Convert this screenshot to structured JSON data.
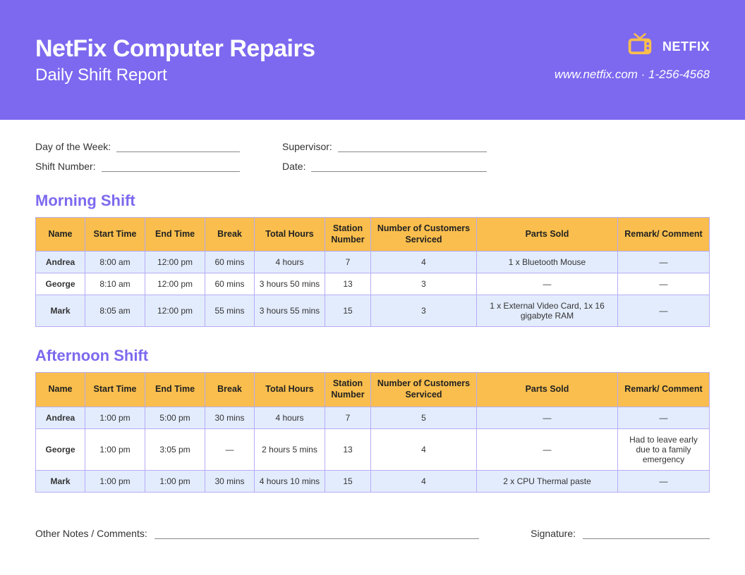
{
  "header": {
    "title": "NetFix Computer Repairs",
    "subtitle": "Daily Shift Report",
    "brand": "NETFIX",
    "contact": "www.netfix.com · 1-256-4568"
  },
  "meta": {
    "day_label": "Day of the Week:",
    "shift_label": "Shift Number:",
    "supervisor_label": "Supervisor:",
    "date_label": "Date:"
  },
  "columns": {
    "name": "Name",
    "start": "Start Time",
    "end": "End Time",
    "break": "Break",
    "total": "Total Hours",
    "station": "Station Number",
    "customers": "Number of Customers Serviced",
    "parts": "Parts Sold",
    "remark": "Remark/ Comment"
  },
  "sections": {
    "morning": {
      "title": "Morning Shift",
      "rows": [
        {
          "name": "Andrea",
          "start": "8:00 am",
          "end": "12:00 pm",
          "break": "60 mins",
          "total": "4 hours",
          "station": "7",
          "customers": "4",
          "parts": "1 x Bluetooth Mouse",
          "remark": "—"
        },
        {
          "name": "George",
          "start": "8:10 am",
          "end": "12:00 pm",
          "break": "60 mins",
          "total": "3 hours 50 mins",
          "station": "13",
          "customers": "3",
          "parts": "—",
          "remark": "—"
        },
        {
          "name": "Mark",
          "start": "8:05 am",
          "end": "12:00 pm",
          "break": "55 mins",
          "total": "3 hours 55 mins",
          "station": "15",
          "customers": "3",
          "parts": "1 x External Video Card, 1x 16 gigabyte RAM",
          "remark": "—"
        }
      ]
    },
    "afternoon": {
      "title": "Afternoon Shift",
      "rows": [
        {
          "name": "Andrea",
          "start": "1:00 pm",
          "end": "5:00 pm",
          "break": "30 mins",
          "total": "4 hours",
          "station": "7",
          "customers": "5",
          "parts": "—",
          "remark": "—"
        },
        {
          "name": "George",
          "start": "1:00 pm",
          "end": "3:05 pm",
          "break": "—",
          "total": "2 hours 5 mins",
          "station": "13",
          "customers": "4",
          "parts": "—",
          "remark": "Had to leave early due to a family emergency"
        },
        {
          "name": "Mark",
          "start": "1:00 pm",
          "end": "1:00 pm",
          "break": "30 mins",
          "total": "4 hours 10 mins",
          "station": "15",
          "customers": "4",
          "parts": "2 x CPU Thermal paste",
          "remark": "—"
        }
      ]
    }
  },
  "footer": {
    "notes_label": "Other Notes / Comments:",
    "signature_label": "Signature:"
  }
}
